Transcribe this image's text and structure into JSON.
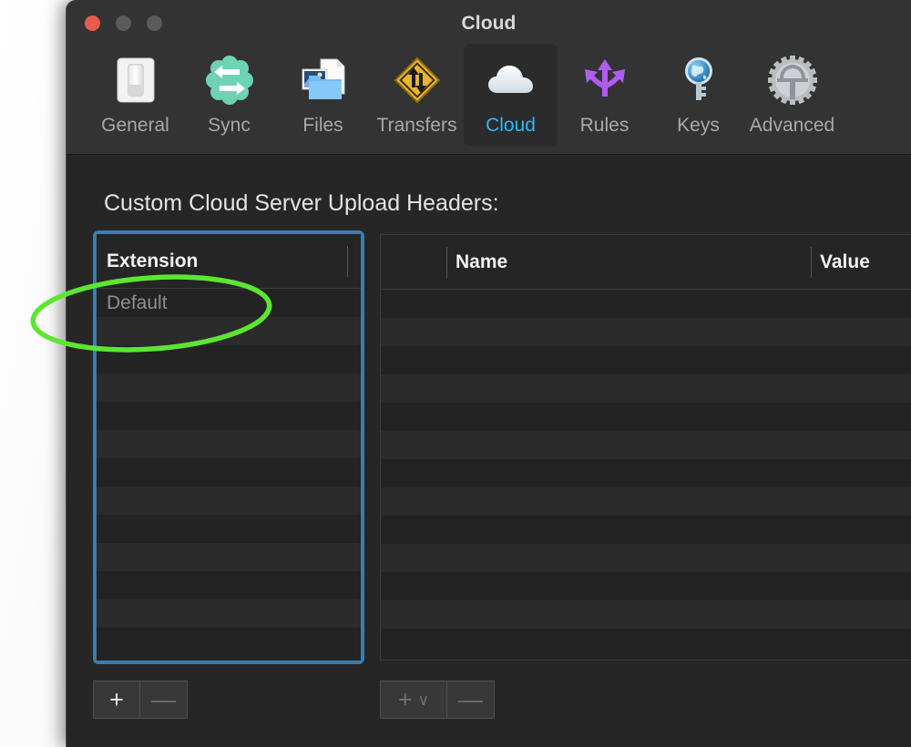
{
  "window": {
    "title": "Cloud",
    "traffic_lights": [
      {
        "name": "close",
        "color": "#e8594f"
      },
      {
        "name": "minimize",
        "color": "#5a5a5a"
      },
      {
        "name": "maximize",
        "color": "#5a5a5a"
      }
    ]
  },
  "toolbar": {
    "tabs": [
      {
        "label": "General",
        "icon": "toggle-switch-icon",
        "selected": false
      },
      {
        "label": "Sync",
        "icon": "sync-arrows-icon",
        "selected": false
      },
      {
        "label": "Files",
        "icon": "folder-files-icon",
        "selected": false
      },
      {
        "label": "Transfers",
        "icon": "transfer-sign-icon",
        "selected": false
      },
      {
        "label": "Cloud",
        "icon": "cloud-icon",
        "selected": true
      },
      {
        "label": "Rules",
        "icon": "branch-arrows-icon",
        "selected": false
      },
      {
        "label": "Keys",
        "icon": "globe-key-icon",
        "selected": false
      },
      {
        "label": "Advanced",
        "icon": "gear-icon",
        "selected": false
      }
    ],
    "selected_tab_color": "#2cb8f7"
  },
  "content": {
    "section_title": "Custom Cloud Server Upload Headers:",
    "left_table": {
      "focused": true,
      "focus_ring_color": "#3d7cab",
      "columns": [
        "Extension"
      ],
      "rows": [
        {
          "extension": "Default"
        },
        {
          "extension": ""
        },
        {
          "extension": ""
        },
        {
          "extension": ""
        },
        {
          "extension": ""
        },
        {
          "extension": ""
        },
        {
          "extension": ""
        },
        {
          "extension": ""
        },
        {
          "extension": ""
        },
        {
          "extension": ""
        },
        {
          "extension": ""
        },
        {
          "extension": ""
        },
        {
          "extension": ""
        }
      ],
      "add_button": {
        "glyph": "+",
        "name": "add-extension-button",
        "enabled": true
      },
      "remove_button": {
        "glyph": "—",
        "name": "remove-extension-button",
        "enabled": false
      }
    },
    "right_table": {
      "focused": false,
      "columns": [
        "Name",
        "Value"
      ],
      "rows": [
        {
          "name": "",
          "value": ""
        },
        {
          "name": "",
          "value": ""
        },
        {
          "name": "",
          "value": ""
        },
        {
          "name": "",
          "value": ""
        },
        {
          "name": "",
          "value": ""
        },
        {
          "name": "",
          "value": ""
        },
        {
          "name": "",
          "value": ""
        },
        {
          "name": "",
          "value": ""
        },
        {
          "name": "",
          "value": ""
        },
        {
          "name": "",
          "value": ""
        },
        {
          "name": "",
          "value": ""
        },
        {
          "name": "",
          "value": ""
        },
        {
          "name": "",
          "value": ""
        }
      ],
      "add_button": {
        "glyph": "+",
        "chevron": "∨",
        "name": "add-header-button",
        "enabled": false
      },
      "remove_button": {
        "glyph": "—",
        "name": "remove-header-button",
        "enabled": false
      }
    }
  },
  "annotation": {
    "shape": "ellipse",
    "color": "#5ce632",
    "target": "Default"
  }
}
